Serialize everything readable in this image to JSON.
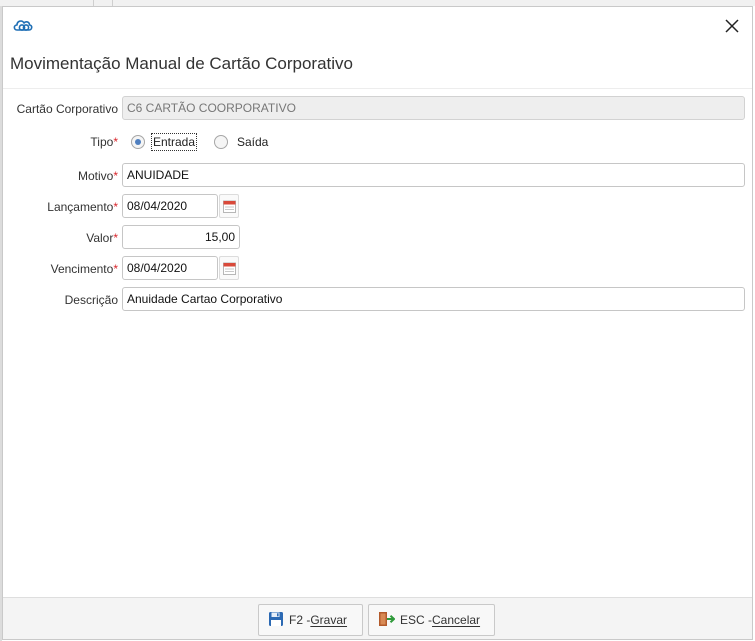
{
  "dialog": {
    "title": "Movimentação Manual de Cartão Corporativo",
    "logo_icon": "cloud-logo-icon",
    "close_icon": "close-icon"
  },
  "form": {
    "cartao": {
      "label": "Cartão Corporativo",
      "value": "C6 CARTÃO COORPORATIVO"
    },
    "tipo": {
      "label": "Tipo",
      "required_mark": "*",
      "options": [
        {
          "label": "Entrada",
          "selected": true
        },
        {
          "label": "Saída",
          "selected": false
        }
      ]
    },
    "motivo": {
      "label": "Motivo",
      "required_mark": "*",
      "value": "ANUIDADE"
    },
    "lancamento": {
      "label": "Lançamento",
      "required_mark": "*",
      "value": "08/04/2020"
    },
    "valor": {
      "label": "Valor",
      "required_mark": "*",
      "value": "15,00"
    },
    "vencimento": {
      "label": "Vencimento",
      "required_mark": "*",
      "value": "08/04/2020"
    },
    "descricao": {
      "label": "Descrição",
      "value": "Anuidade Cartao Corporativo"
    }
  },
  "footer": {
    "save": {
      "key": "F2 - ",
      "action": "Gravar",
      "icon": "floppy-disk-icon"
    },
    "cancel": {
      "key": "ESC - ",
      "action": "Cancelar",
      "icon": "exit-door-icon"
    }
  },
  "colors": {
    "required": "#d9262c",
    "accent": "#1f6fb5",
    "readonly_bg": "#eeeeee"
  }
}
